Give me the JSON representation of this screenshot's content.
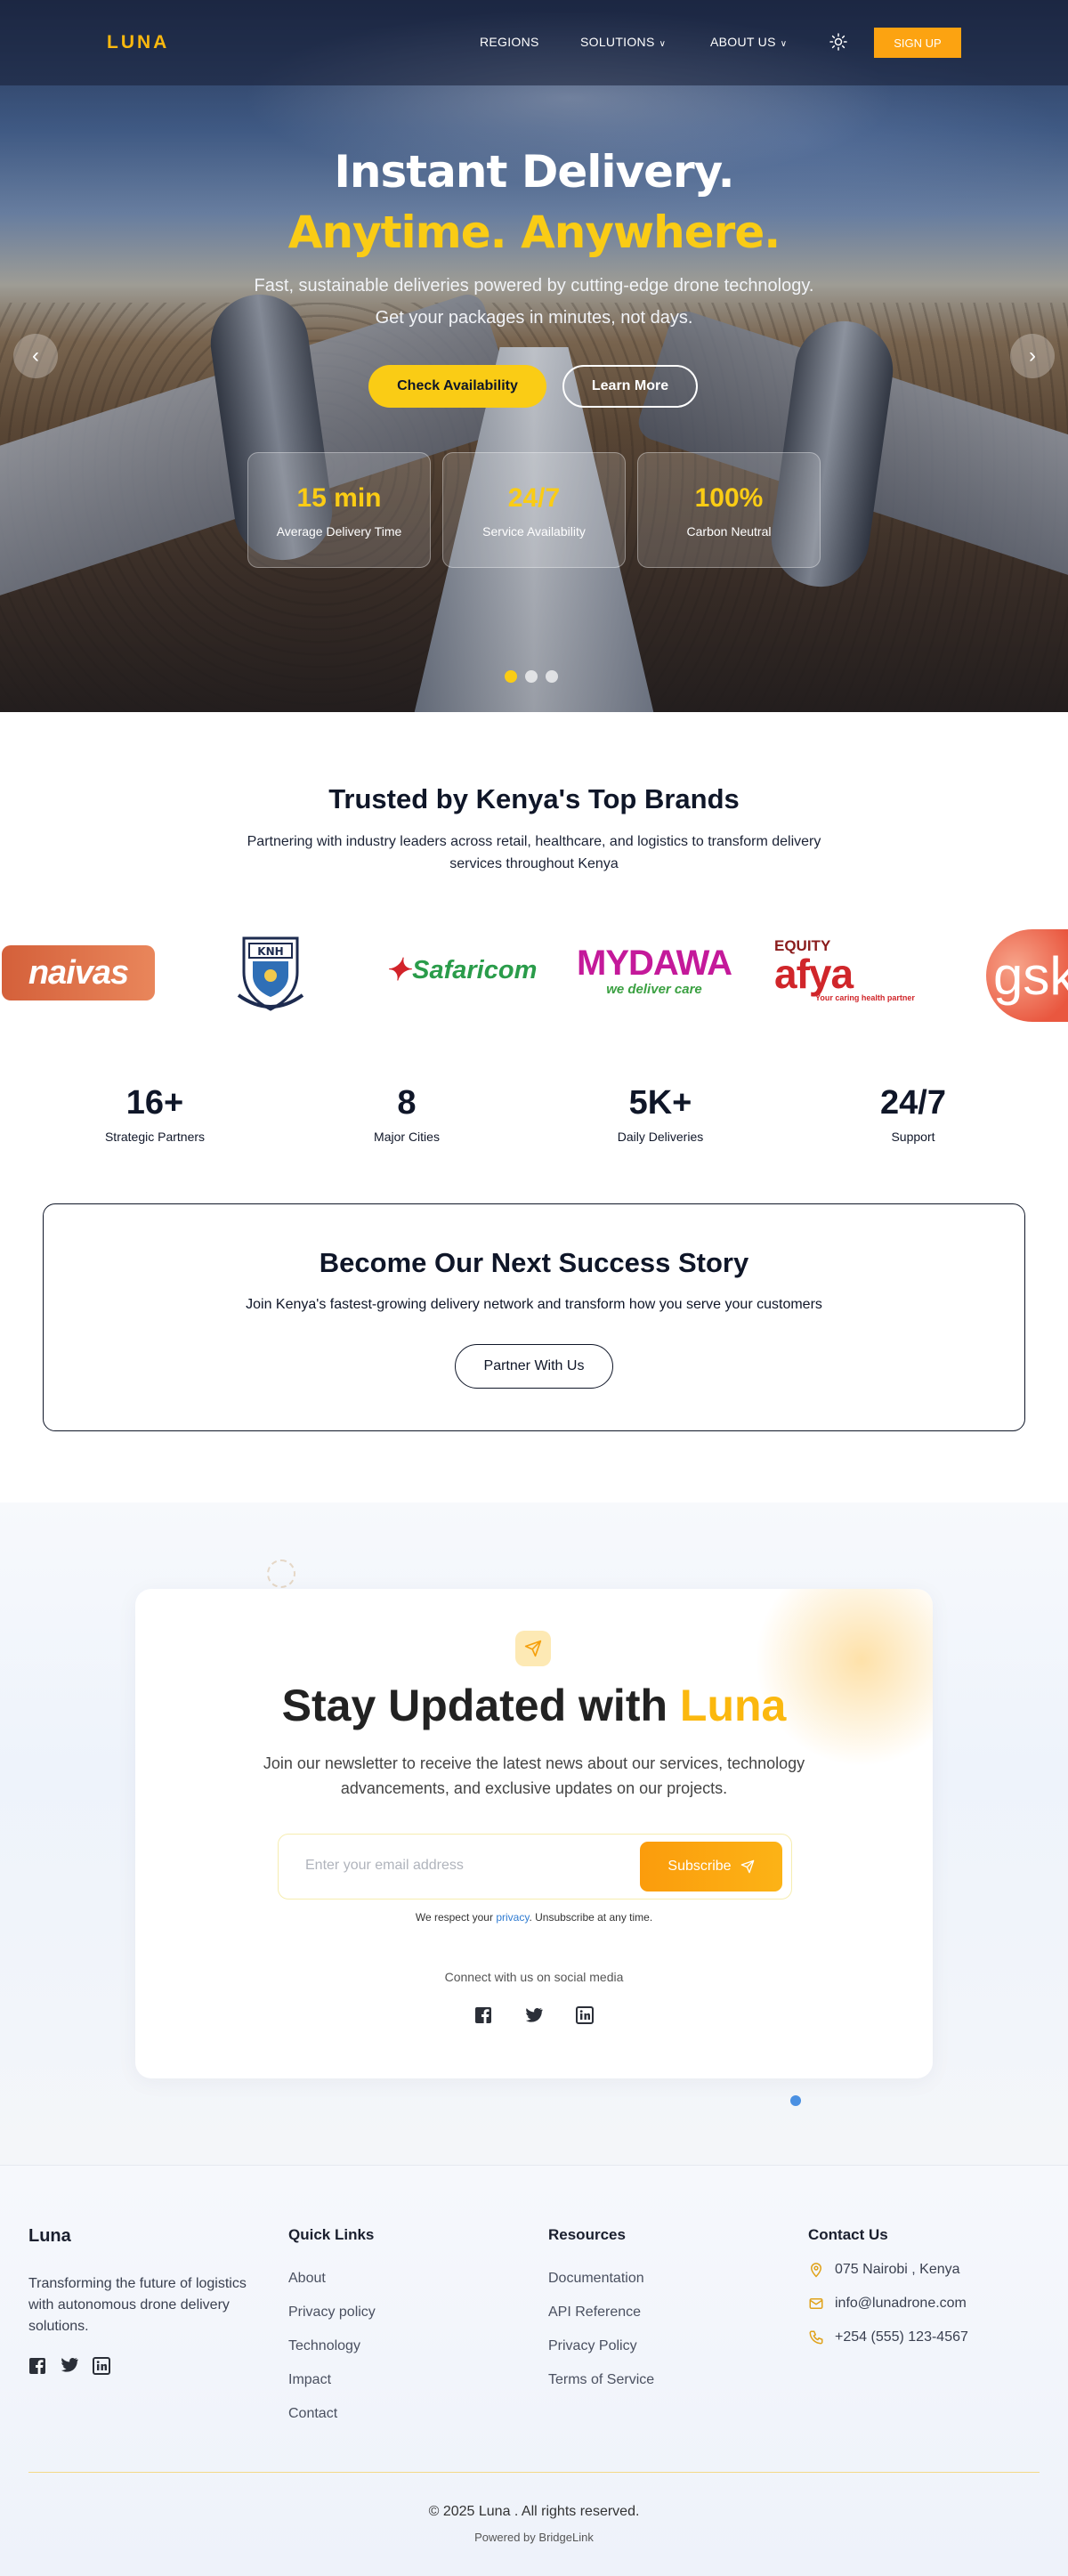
{
  "nav": {
    "logo": "LUNA",
    "items": [
      {
        "label": "REGIONS",
        "has_dropdown": false
      },
      {
        "label": "SOLUTIONS",
        "has_dropdown": true
      },
      {
        "label": "ABOUT US",
        "has_dropdown": true
      }
    ],
    "theme_icon": "sun-icon",
    "signup_label": "SIGN UP"
  },
  "hero": {
    "title_line1": "Instant Delivery.",
    "title_line2": "Anytime. Anywhere.",
    "subtitle_line1": "Fast, sustainable deliveries powered by cutting-edge drone technology.",
    "subtitle_line2": "Get your packages in minutes, not days.",
    "primary_cta": "Check Availability",
    "secondary_cta": "Learn More",
    "stats": [
      {
        "value": "15 min",
        "label": "Average Delivery Time"
      },
      {
        "value": "24/7",
        "label": "Service Availability"
      },
      {
        "value": "100%",
        "label": "Carbon Neutral"
      }
    ],
    "slides": {
      "count": 3,
      "active": 0
    },
    "prev_icon": "chevron-left-icon",
    "next_icon": "chevron-right-icon"
  },
  "brands": {
    "title": "Trusted by Kenya's Top Brands",
    "subtitle": "Partnering with industry leaders across retail, healthcare, and logistics to transform delivery services throughout Kenya",
    "logos": {
      "naivas": "naivas",
      "knh": "KNH",
      "safaricom": "Safaricom",
      "mydawa_a": "MY",
      "mydawa_b": "DAWA",
      "mydawa_tag": "we deliver care",
      "afya_top": "EQUITY",
      "afya_main": "afya",
      "afya_tag": "Your caring health partner",
      "gsk": "gsk"
    }
  },
  "kpis": [
    {
      "value": "16+",
      "label": "Strategic Partners"
    },
    {
      "value": "8",
      "label": "Major Cities"
    },
    {
      "value": "5K+",
      "label": "Daily Deliveries"
    },
    {
      "value": "24/7",
      "label": "Support"
    }
  ],
  "success": {
    "title": "Become Our Next Success Story",
    "subtitle": "Join Kenya's fastest-growing delivery network and transform how you serve your customers",
    "cta": "Partner With Us"
  },
  "newsletter": {
    "title_prefix": "Stay Updated with ",
    "title_accent": "Luna",
    "subtitle": "Join our newsletter to receive the latest news about our services, technology advancements, and exclusive updates on our projects.",
    "email_placeholder": "Enter your email address",
    "email_value": "",
    "subscribe_label": "Subscribe",
    "privacy_prefix": "We respect your ",
    "privacy_link": "privacy",
    "privacy_suffix": ". Unsubscribe at any time.",
    "connect_label": "Connect with us on social media",
    "social_icons": [
      "facebook-icon",
      "twitter-icon",
      "linkedin-icon"
    ]
  },
  "footer": {
    "brand": "Luna",
    "description": "Transforming the future of logistics with autonomous drone delivery solutions.",
    "quick_links": {
      "heading": "Quick Links",
      "items": [
        "About",
        "Privacy policy",
        "Technology",
        "Impact",
        "Contact"
      ]
    },
    "resources": {
      "heading": "Resources",
      "items": [
        "Documentation",
        "API Reference",
        "Privacy Policy",
        "Terms of Service"
      ]
    },
    "contact": {
      "heading": "Contact Us",
      "address": "075 Nairobi , Kenya",
      "email": "info@lunadrone.com",
      "phone": "+254 (555) 123-4567"
    },
    "copyright": "© 2025 Luna . All rights reserved.",
    "powered_by": "Powered by BridgeLink"
  },
  "colors": {
    "accent_yellow": "#facc15",
    "accent_orange": "#fca311",
    "navy": "#0f1628",
    "link_blue": "#2f7bd1"
  }
}
